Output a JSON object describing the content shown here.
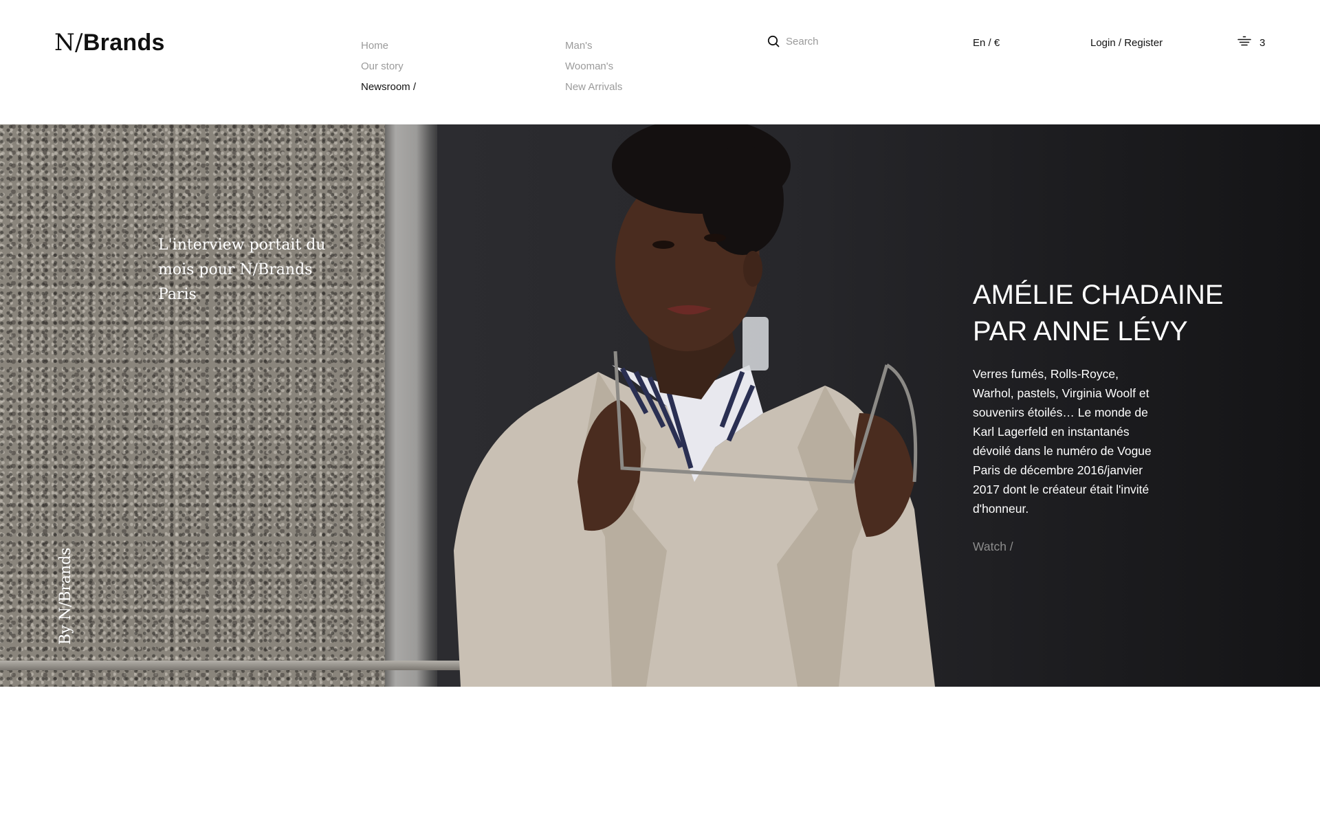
{
  "header": {
    "logo_serif": "N/",
    "logo_sans": "Brands",
    "nav_col_1": [
      "Home",
      "Our story",
      "Newsroom /"
    ],
    "nav_col_2": [
      "Man's",
      "Wooman's",
      "New Arrivals"
    ],
    "active_nav": "Newsroom /",
    "search_placeholder": "Search",
    "lang": "En / €",
    "login": "Login / Register",
    "cart_count": "3",
    "search_icon": "search-icon",
    "cart_icon": "cart-icon"
  },
  "hero": {
    "quote": "L'interview portait du mois pour N/Brands Paris",
    "byline": "By N/Brands",
    "title_line1": "AMÉLIE CHADAINE",
    "title_line2": "PAR ANNE LÉVY",
    "description": "Verres fumés, Rolls-Royce, Warhol, pastels, Virginia Woolf et souvenirs étoilés… Le monde de Karl Lagerfeld en instantanés dévoilé dans le numéro de Vogue Paris de décembre 2016/janvier 2017 dont le créateur était l'invité d'honneur.",
    "watch_label": "Watch /"
  },
  "colors": {
    "text": "#111111",
    "muted": "#9a9a9a",
    "hero_dark": "#1e1e21",
    "watch": "#8d8d8d"
  }
}
